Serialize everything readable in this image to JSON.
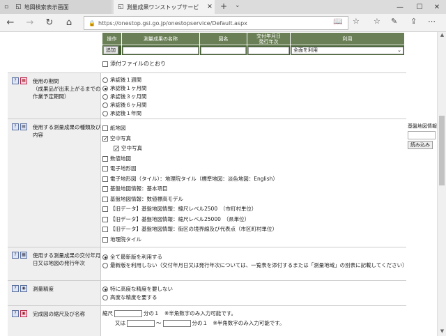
{
  "browser": {
    "tabs": [
      {
        "title": "地図検索表示画面"
      },
      {
        "title": "測量成果ワンストップサービ"
      }
    ],
    "url": "https://onestop.gsi.go.jp/onestopservice/Default.aspx"
  },
  "request_table": {
    "headers": [
      "操作",
      "測量成果の名称",
      "図名",
      "交付年月日\n発行年次",
      "利用"
    ],
    "add_label": "追加",
    "usage_value": "全面を利用"
  },
  "attach": {
    "label": "添付ファイルのとおり"
  },
  "period": {
    "label": "使用の期間\n（成果品が出来上がるまでの作業予定期間）",
    "options": [
      "承認後１週間",
      "承認後１ヶ月間",
      "承認後３ヶ月間",
      "承認後６ヶ月間",
      "承認後１年間"
    ],
    "selected": 1
  },
  "types": {
    "label": "使用する測量成果の種類及び内容",
    "items": [
      {
        "label": "紙地図",
        "checked": false,
        "indent": 0
      },
      {
        "label": "空中写真",
        "checked": true,
        "indent": 0
      },
      {
        "label": "空中写真",
        "checked": true,
        "indent": 1
      },
      {
        "label": "数値地図",
        "checked": false,
        "indent": 0
      },
      {
        "label": "電子地形図",
        "checked": false,
        "indent": 0
      },
      {
        "label": "電子地形図（タイル）：地理院タイル（標準地図：淡色地図：English）",
        "checked": false,
        "indent": 0
      },
      {
        "label": "基盤地図情報：基本項目",
        "checked": false,
        "indent": 0
      },
      {
        "label": "基盤地図情報：数値標高モデル",
        "checked": false,
        "indent": 0
      },
      {
        "label": "【旧データ】基盤地図情報：縮尺レベル2500　（市町村単位）",
        "checked": false,
        "indent": 0
      },
      {
        "label": "【旧データ】基盤地図情報：縮尺レベル25000　（県単位）",
        "checked": false,
        "indent": 0
      },
      {
        "label": "【旧データ】基盤地図情報：街区の境界線及び代表点（市区町村単位）",
        "checked": false,
        "indent": 0
      },
      {
        "label": "地理院タイル",
        "checked": false,
        "indent": 0
      }
    ],
    "side_label": "基盤地図情報",
    "side_button": "読み込み"
  },
  "edition": {
    "label": "使用する測量成果の交付年月日又は地図の発行年次",
    "options": [
      "全て最新版を利用する",
      "最新版を利用しない（交付年月日又は発行年次については、一覧表を添付するまたは「測量地域」の別表に記載してください）"
    ],
    "selected": 0
  },
  "accuracy": {
    "label": "測量精度",
    "options": [
      "特に高度な精度を要しない",
      "高度な精度を要する"
    ],
    "selected": 0
  },
  "scale": {
    "label": "完成図の縮尺及び名称",
    "row1_prefix": "縮尺",
    "row1_suffix": "分の１　※半角数字のみ入力可能です。",
    "row2_prefix": "又は",
    "row2_tilde": "～",
    "row2_suffix": "分の１　※半角数字のみ入力可能です。"
  }
}
